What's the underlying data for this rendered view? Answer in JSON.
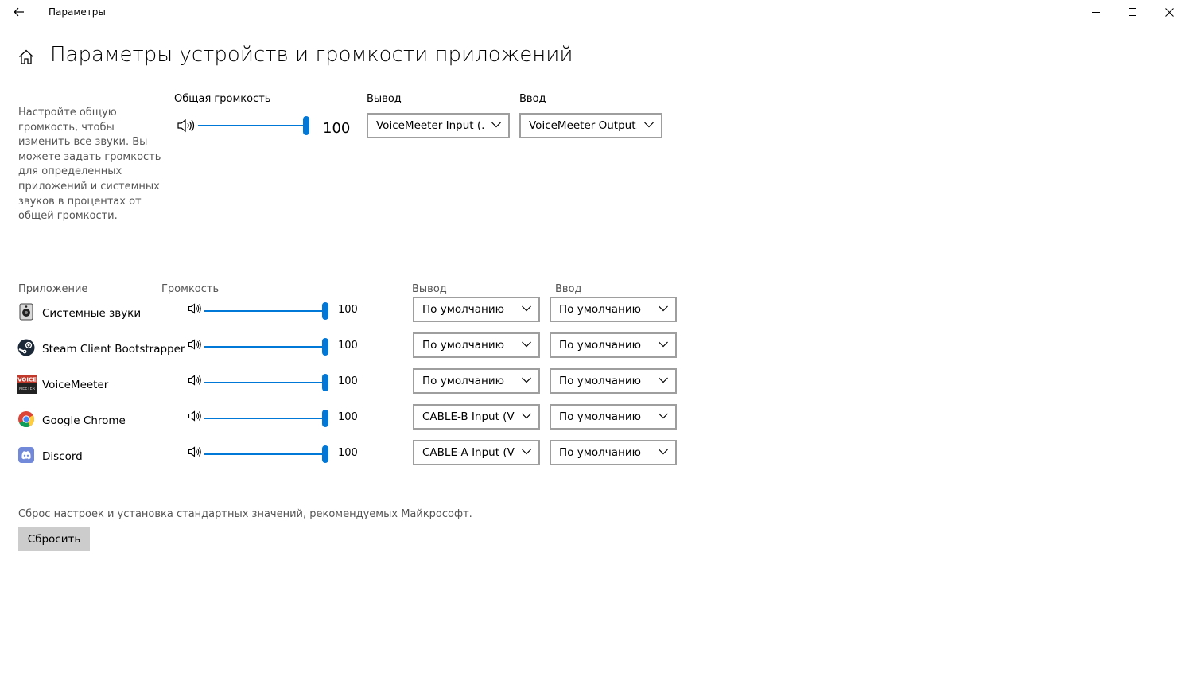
{
  "window": {
    "title": "Параметры"
  },
  "page": {
    "title": "Параметры устройств и громкости приложений"
  },
  "master": {
    "description": "Настройте общую громкость, чтобы изменить все звуки. Вы можете задать громкость для определенных приложений и системных звуков в процентах от общей громкости.",
    "volume_label": "Общая громкость",
    "volume_value": "100",
    "volume_level": 100,
    "output_label": "Вывод",
    "output_value": "VoiceMeeter Input (...",
    "input_label": "Ввод",
    "input_value": "VoiceMeeter Output..."
  },
  "apps_header": {
    "app": "Приложение",
    "volume": "Громкость",
    "output": "Вывод",
    "input": "Ввод"
  },
  "apps": [
    {
      "name": "Системные звуки",
      "icon": "system-sounds-icon",
      "volume": "100",
      "level": 100,
      "output": "По умолчанию",
      "input": "По умолчанию"
    },
    {
      "name": "Steam Client Bootstrapper",
      "icon": "steam-icon",
      "volume": "100",
      "level": 100,
      "output": "По умолчанию",
      "input": "По умолчанию"
    },
    {
      "name": "VoiceMeeter",
      "icon": "voicemeeter-icon",
      "volume": "100",
      "level": 100,
      "output": "По умолчанию",
      "input": "По умолчанию"
    },
    {
      "name": "Google Chrome",
      "icon": "chrome-icon",
      "volume": "100",
      "level": 100,
      "output": "CABLE-B Input (VB-",
      "input": "По умолчанию"
    },
    {
      "name": "Discord",
      "icon": "discord-icon",
      "volume": "100",
      "level": 100,
      "output": "CABLE-A Input (VB",
      "input": "По умолчанию"
    }
  ],
  "voicemeeter_logo": {
    "line1": "VOICE",
    "line2": "MEETER"
  },
  "reset": {
    "description": "Сброс настроек и установка стандартных значений, рекомендуемых Майкрософт.",
    "button_label": "Сбросить"
  },
  "colors": {
    "accent": "#0078d7",
    "border": "#9e9e9e",
    "button_bg": "#cccccc"
  }
}
